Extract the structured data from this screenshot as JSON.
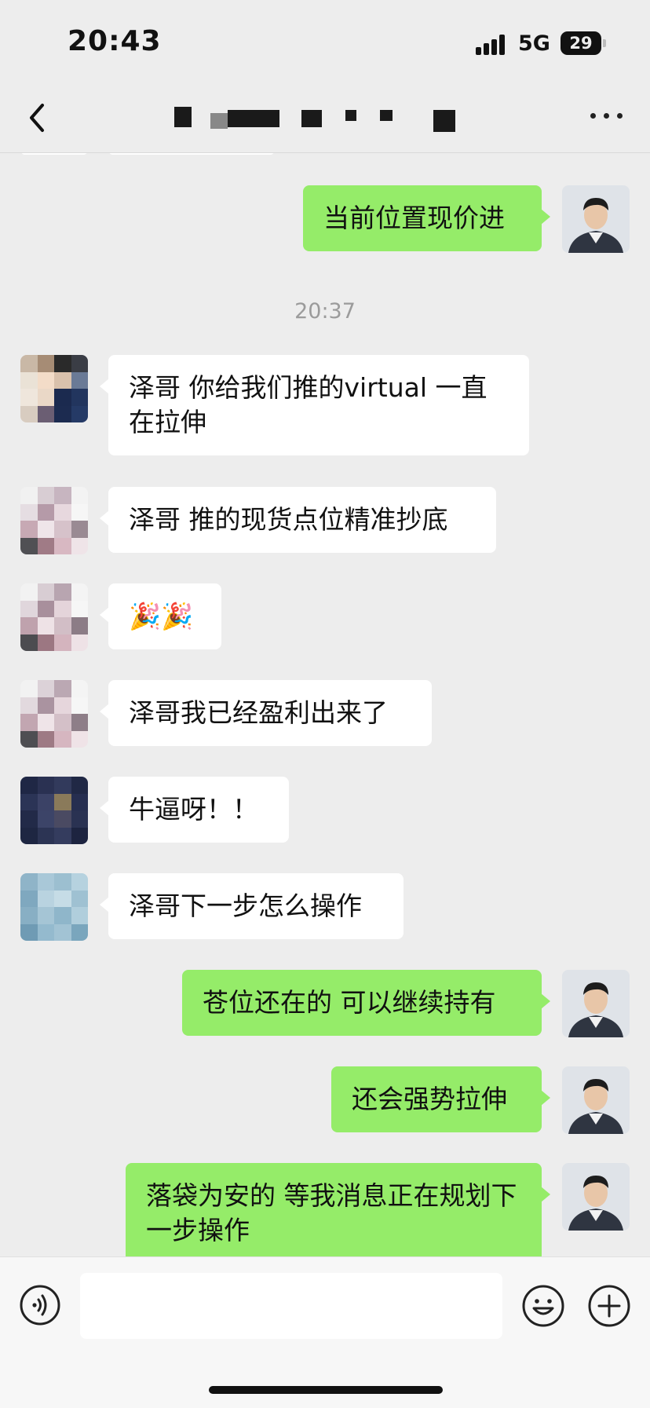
{
  "status_bar": {
    "time": "20:43",
    "network": "5G",
    "battery": "29"
  },
  "nav": {
    "title": ""
  },
  "chat": {
    "timestamp": "20:37",
    "messages": [
      {
        "side": "out",
        "text": "当前位置现价进"
      },
      {
        "side": "in",
        "text": "泽哥 你给我们推的virtual 一直在拉伸"
      },
      {
        "side": "in",
        "text": "泽哥 推的现货点位精准抄底"
      },
      {
        "side": "in",
        "text": "🎉🎉"
      },
      {
        "side": "in",
        "text": "泽哥我已经盈利出来了"
      },
      {
        "side": "in",
        "text": "牛逼呀！！"
      },
      {
        "side": "in",
        "text": "泽哥下一步怎么操作"
      },
      {
        "side": "out",
        "text": "苍位还在的 可以继续持有"
      },
      {
        "side": "out",
        "text": "还会强势拉伸"
      },
      {
        "side": "out",
        "text": "落袋为安的 等我消息正在规划下一步操作"
      }
    ]
  },
  "input_bar": {
    "placeholder": ""
  },
  "colors": {
    "background": "#ededed",
    "bubble_out": "#95ec69",
    "bubble_in": "#ffffff",
    "timestamp": "#9b9b9b"
  },
  "icons": [
    "back-chevron-icon",
    "more-dots-icon",
    "voice-icon",
    "emoji-icon",
    "plus-icon",
    "signal-icon",
    "battery-icon"
  ]
}
